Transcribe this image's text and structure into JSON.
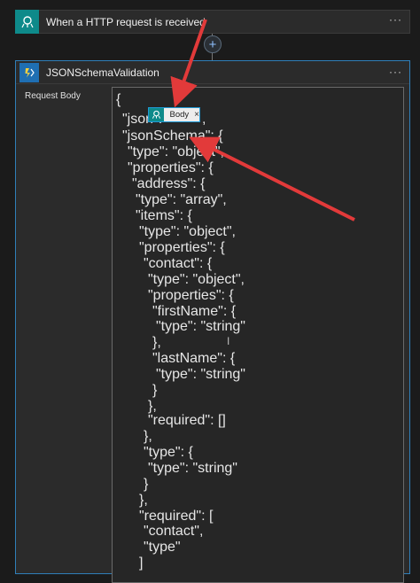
{
  "trigger": {
    "title": "When a HTTP request is received",
    "more": "···"
  },
  "connector": {
    "add_symbol": "+"
  },
  "action": {
    "title": "JSONSchemaValidation",
    "more": "···",
    "field_label": "Request Body"
  },
  "token": {
    "label": "Body",
    "close": "×"
  },
  "code_lines": [
    "{",
    "\"json\":",
    ",",
    "\"jsonSchema\": {",
    "\"type\": \"object\",",
    "\"properties\": {",
    "\"address\": {",
    "\"type\": \"array\",",
    "\"items\": {",
    "\"type\": \"object\",",
    "\"properties\": {",
    "\"contact\": {",
    "\"type\": \"object\",",
    "\"properties\": {",
    "\"firstName\": {",
    "\"type\": \"string\"",
    "},",
    "\"lastName\": {",
    "\"type\": \"string\"",
    "}",
    "},",
    "\"required\": []",
    "},",
    "\"type\": {",
    "\"type\": \"string\"",
    "}",
    "},",
    "\"required\": [",
    "\"contact\",",
    "\"type\"",
    "]"
  ],
  "colors": {
    "accent_red": "#e23a3a",
    "trigger_teal": "#0e8a8a",
    "action_blue": "#1f6fb3"
  },
  "icons": {
    "trigger": "http-request-icon",
    "action": "function-icon",
    "token": "http-request-icon"
  }
}
